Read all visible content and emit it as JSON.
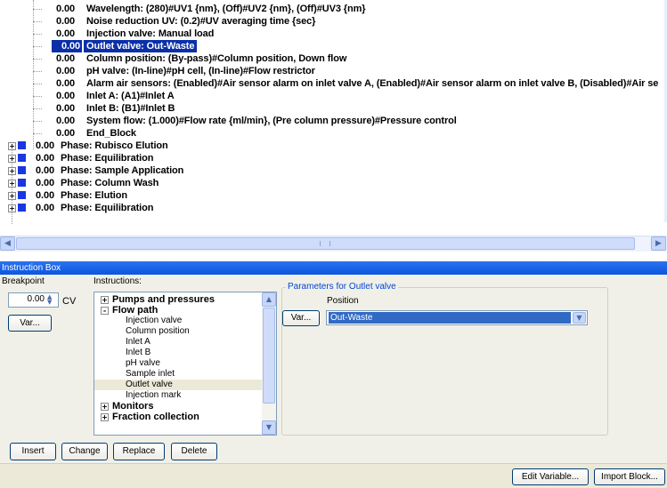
{
  "tree": {
    "rows": [
      {
        "value": "0.00",
        "text": "Wavelength: (280)#UV1 {nm}, (Off)#UV2 {nm}, (Off)#UV3 {nm}"
      },
      {
        "value": "0.00",
        "text": "Noise reduction UV: (0.2)#UV averaging time {sec}"
      },
      {
        "value": "0.00",
        "text": "Injection valve: Manual load"
      },
      {
        "value": "0.00",
        "text": "Outlet valve: Out-Waste",
        "selected": true
      },
      {
        "value": "0.00",
        "text": "Column position: (By-pass)#Column position, Down flow"
      },
      {
        "value": "0.00",
        "text": "pH valve: (In-line)#pH cell, (In-line)#Flow restrictor"
      },
      {
        "value": "0.00",
        "text": "Alarm air sensors: (Enabled)#Air sensor alarm on inlet valve A, (Enabled)#Air sensor alarm on inlet valve B, (Disabled)#Air se"
      },
      {
        "value": "0.00",
        "text": "Inlet A: (A1)#Inlet A"
      },
      {
        "value": "0.00",
        "text": "Inlet B: (B1)#Inlet B"
      },
      {
        "value": "0.00",
        "text": "System flow: (1.000)#Flow rate {ml/min}, (Pre column pressure)#Pressure control"
      },
      {
        "value": "0.00",
        "text": "End_Block"
      }
    ],
    "phases": [
      {
        "value": "0.00",
        "text": "Phase: Rubisco Elution"
      },
      {
        "value": "0.00",
        "text": "Phase: Equilibration"
      },
      {
        "value": "0.00",
        "text": "Phase: Sample Application"
      },
      {
        "value": "0.00",
        "text": "Phase: Column Wash"
      },
      {
        "value": "0.00",
        "text": "Phase: Elution"
      },
      {
        "value": "0.00",
        "text": "Phase: Equilibration"
      }
    ],
    "phase_color": "#1a36e0",
    "selection_color": "#0a2fa8"
  },
  "instruction_box": {
    "title": "Instruction Box",
    "breakpoint_label": "Breakpoint",
    "breakpoint_value": "0.00",
    "breakpoint_unit": "CV",
    "var_button": "Var...",
    "instructions_label": "Instructions:",
    "instructions": [
      {
        "label": "Pumps and pressures",
        "group": true,
        "expander": "+"
      },
      {
        "label": "Flow path",
        "group": true,
        "expander": "−"
      },
      {
        "label": "Injection valve"
      },
      {
        "label": "Column position"
      },
      {
        "label": "Inlet A"
      },
      {
        "label": "Inlet B"
      },
      {
        "label": "pH valve"
      },
      {
        "label": "Sample inlet"
      },
      {
        "label": "Outlet valve",
        "selected": true
      },
      {
        "label": "Injection mark"
      },
      {
        "label": "Monitors",
        "group": true,
        "expander": "+"
      },
      {
        "label": "Fraction collection",
        "group": true,
        "expander": "+"
      }
    ],
    "params_legend": "Parameters for Outlet valve",
    "position_label": "Position",
    "param_var_button": "Var...",
    "position_value": "Out-Waste",
    "buttons": {
      "insert": "Insert",
      "change": "Change",
      "replace": "Replace",
      "delete": "Delete"
    }
  },
  "statusbar": {
    "edit_variable": "Edit Variable...",
    "import_block": "Import Block..."
  },
  "colors": {
    "title_bar": "#0a56e0",
    "dropdown_selection": "#316ac5",
    "legend_text": "#0046d5"
  }
}
